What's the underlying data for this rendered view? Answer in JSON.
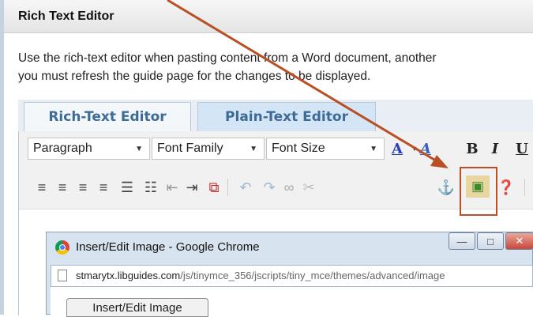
{
  "panel": {
    "title": "Rich Text Editor",
    "description_line1": "Use the rich-text editor when pasting content from a Word document, another",
    "description_line2": "you must refresh the guide page for the changes to be displayed."
  },
  "tabs": [
    {
      "label": "Rich-Text Editor"
    },
    {
      "label": "Plain-Text Editor"
    }
  ],
  "toolbar": {
    "format_select": "Paragraph",
    "font_family_select": "Font Family",
    "font_size_select": "Font Size",
    "bold_label": "B",
    "italic_label": "I",
    "underline_label": "U",
    "font_color_label": "A",
    "highlight_label": "A",
    "icons": [
      "align-left-icon",
      "align-center-icon",
      "align-right-icon",
      "align-justify-icon",
      "bullet-list-icon",
      "numbered-list-icon",
      "outdent-icon",
      "indent-icon",
      "blockquote-icon",
      "undo-icon",
      "redo-icon",
      "link-icon",
      "unlink-icon",
      "anchor-icon",
      "insert-image-icon",
      "help-icon"
    ]
  },
  "dialog": {
    "window_title": "Insert/Edit Image - Google Chrome",
    "url_host": "stmarytx.libguides.com",
    "url_path": "/js/tinymce_356/jscripts/tiny_mce/themes/advanced/image",
    "tab_label": "Insert/Edit Image"
  },
  "annotation": {
    "arrow_color": "#b94f24",
    "highlight_color": "#b94f24"
  }
}
